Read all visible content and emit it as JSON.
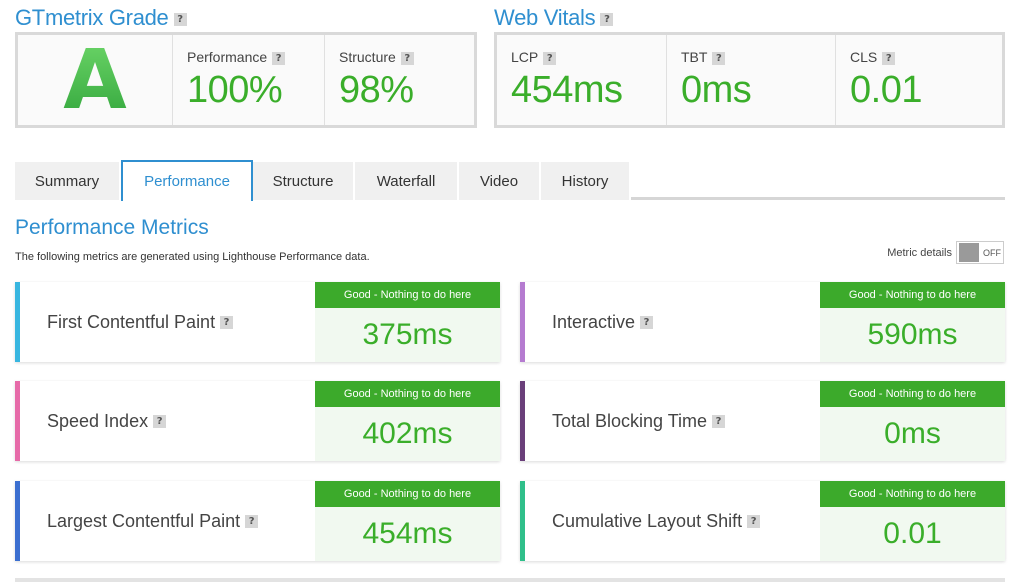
{
  "grade": {
    "title": "GTmetrix Grade",
    "letter": "A",
    "performance_label": "Performance",
    "performance_value": "100%",
    "structure_label": "Structure",
    "structure_value": "98%"
  },
  "vitals": {
    "title": "Web Vitals",
    "items": [
      {
        "label": "LCP",
        "value": "454ms"
      },
      {
        "label": "TBT",
        "value": "0ms"
      },
      {
        "label": "CLS",
        "value": "0.01"
      }
    ]
  },
  "help_glyph": "?",
  "tabs": [
    "Summary",
    "Performance",
    "Structure",
    "Waterfall",
    "Video",
    "History"
  ],
  "active_tab": "Performance",
  "metrics": {
    "title": "Performance Metrics",
    "description": "The following metrics are generated using Lighthouse Performance data.",
    "details_label": "Metric details",
    "details_state": "OFF",
    "badge_text": "Good - Nothing to do here",
    "cards": [
      {
        "name": "First Contentful Paint",
        "value": "375ms",
        "color": "#38b6e0"
      },
      {
        "name": "Interactive",
        "value": "590ms",
        "color": "#b57bd0"
      },
      {
        "name": "Speed Index",
        "value": "402ms",
        "color": "#e66aa8"
      },
      {
        "name": "Total Blocking Time",
        "value": "0ms",
        "color": "#6a3f7a"
      },
      {
        "name": "Largest Contentful Paint",
        "value": "454ms",
        "color": "#3b6fd0"
      },
      {
        "name": "Cumulative Layout Shift",
        "value": "0.01",
        "color": "#2fbf8a"
      }
    ]
  },
  "colors": {
    "accent": "#2f8fd0",
    "good": "#3caa2b",
    "good_bg": "#f1f9f0"
  }
}
